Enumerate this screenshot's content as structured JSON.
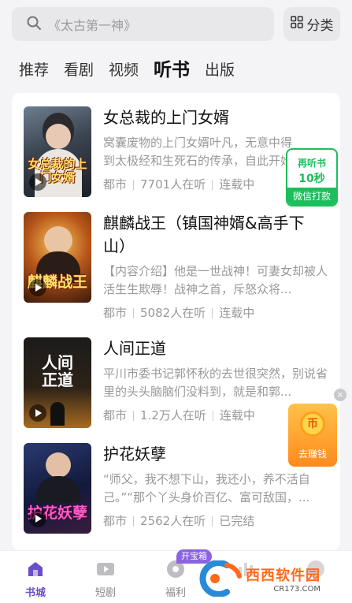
{
  "search": {
    "placeholder": "《太古第一神》"
  },
  "category_button": {
    "label": "分类"
  },
  "tabs": [
    {
      "label": "推荐",
      "active": false
    },
    {
      "label": "看剧",
      "active": false
    },
    {
      "label": "视频",
      "active": false
    },
    {
      "label": "听书",
      "active": true
    },
    {
      "label": "出版",
      "active": false
    }
  ],
  "books": [
    {
      "title": "女总裁的上门女婿",
      "cover_text": "女总裁的上门女婿",
      "description": "窝囊废物的上门女婿叶凡，无意中得到太极经和生死石的传承，自此开始",
      "genre": "都市",
      "listeners": "7701人在听",
      "status": "连载中"
    },
    {
      "title": "麒麟战王（镇国神婿&高手下山）",
      "cover_text": "麒麟战王",
      "description": "【内容介绍】他是一世战神！可妻女却被人活生生欺辱！战神之首，斥怒众将...",
      "genre": "都市",
      "listeners": "5082人在听",
      "status": "连载中"
    },
    {
      "title": "人间正道",
      "cover_text": "人间正道",
      "description": "平川市委书记郭怀秋的去世很突然，别说省里的头头脑脑们没料到，就是和郭...",
      "genre": "都市",
      "listeners": "1.2万人在听",
      "status": "连载中"
    },
    {
      "title": "护花妖孽",
      "cover_text": "护花妖孽",
      "description": "“师父，我不想下山，我还小，养不活自己。”“那个丫头身价百亿、富可敌国，...",
      "genre": "都市",
      "listeners": "2562人在听",
      "status": "已完结"
    }
  ],
  "float_listen": {
    "line1": "再听书",
    "line2": "10秒",
    "line3": "微信打款"
  },
  "float_earn": {
    "coin": "币",
    "label": "去赚钱"
  },
  "close_symbol": "×",
  "bottom_nav": [
    {
      "label": "书城",
      "active": true
    },
    {
      "label": "短剧",
      "active": false
    },
    {
      "label": "福利",
      "active": false
    }
  ],
  "badge": "开宝箱",
  "watermark": {
    "title": "西西软件园",
    "url": "CR173.COM"
  },
  "colors": {
    "accent": "#6a4fc7",
    "green": "#1dbe5c",
    "orange": "#ff8a1c"
  }
}
